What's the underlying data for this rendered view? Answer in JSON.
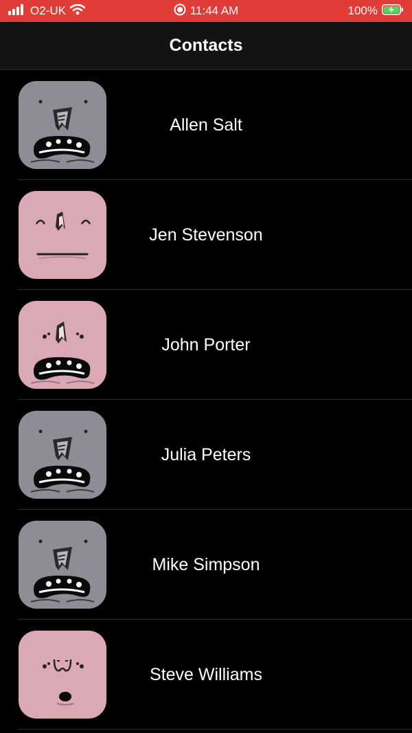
{
  "status_bar": {
    "carrier": "O2-UK",
    "time": "11:44 AM",
    "battery": "100%",
    "icons": [
      "signal-icon",
      "wifi-icon",
      "recording-icon",
      "battery-charging-icon"
    ]
  },
  "nav": {
    "title": "Contacts"
  },
  "colors": {
    "status_bar": "#e03c38",
    "nav_bar": "#131313",
    "background": "#000000",
    "avatar_grey": "#8e8c94",
    "avatar_pink": "#dba8b6"
  },
  "contacts": [
    {
      "name": "Allen Salt",
      "avatar": "grey-monster-open-mouth"
    },
    {
      "name": "Jen Stevenson",
      "avatar": "pink-monster-closed-mouth"
    },
    {
      "name": "John Porter",
      "avatar": "pink-monster-open-mouth"
    },
    {
      "name": "Julia Peters",
      "avatar": "grey-monster-open-mouth"
    },
    {
      "name": "Mike Simpson",
      "avatar": "grey-monster-open-mouth"
    },
    {
      "name": "Steve Williams",
      "avatar": "pink-monster-small-mouth"
    }
  ]
}
